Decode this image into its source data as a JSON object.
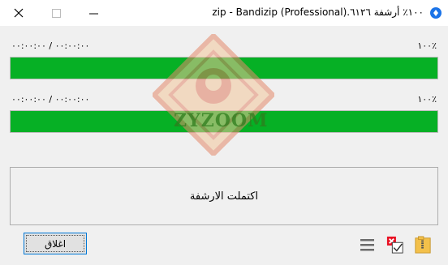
{
  "window": {
    "title": "١٠٠٪ أرشفة ٦١٢٦.zip - Bandizip (Professional)",
    "minimize_icon": "minimize-icon",
    "maximize_icon": "maximize-icon",
    "close_icon": "close-icon"
  },
  "progress": [
    {
      "time": "٠٠:٠٠:٠٠ / ٠٠:٠٠:٠٠",
      "percent_label": "١٠٠٪",
      "fraction": 1.0
    },
    {
      "time": "٠٠:٠٠:٠٠ / ٠٠:٠٠:٠٠",
      "percent_label": "١٠٠٪",
      "fraction": 1.0
    }
  ],
  "status": {
    "message": "اكتملت الارشفة"
  },
  "buttons": {
    "close_label": "اغلاق"
  },
  "watermark": {
    "text": "ZYZOOM"
  },
  "colors": {
    "progress_fill": "#06b025",
    "accent": "#0078d7"
  }
}
